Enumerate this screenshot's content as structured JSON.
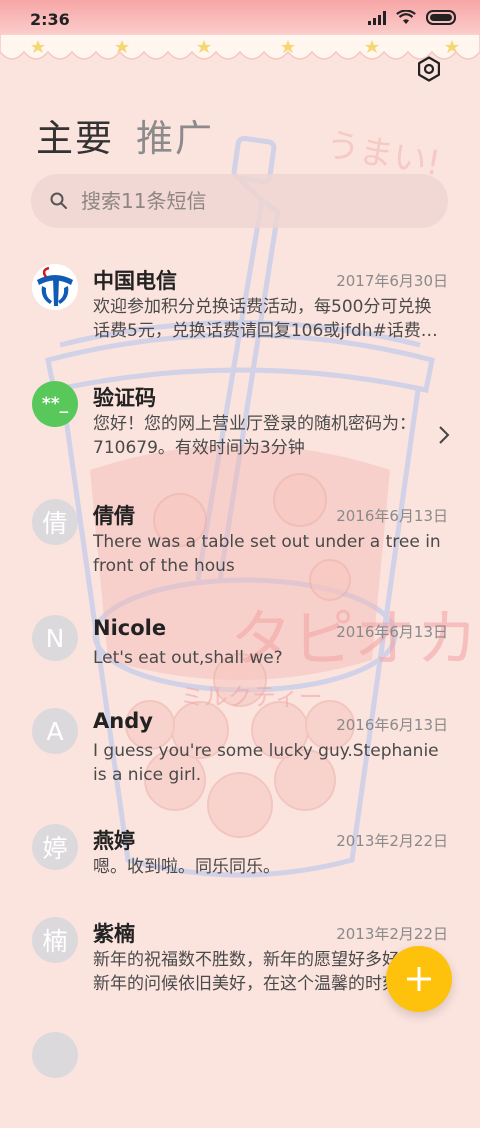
{
  "status": {
    "time": "2:36"
  },
  "tabs": [
    {
      "label": "主要",
      "active": true
    },
    {
      "label": "推广",
      "active": false
    }
  ],
  "search": {
    "placeholder": "搜索11条短信"
  },
  "messages": [
    {
      "name": "中国电信",
      "date": "2017年6月30日",
      "preview": "欢迎参加积分兑换话费活动，每500分可兑换话费5元，兑换话费请回复106或jfdh#话费…",
      "avatar": "telecom-logo"
    },
    {
      "name": "验证码",
      "date": "",
      "preview": "您好！您的网上营业厅登录的随机密码为：710679。有效时间为3分钟",
      "avatar_text": "**_"
    },
    {
      "name": "倩倩",
      "date": "2016年6月13日",
      "preview": "There was a table set out under a tree in front of the hous",
      "avatar_text": "倩"
    },
    {
      "name": "Nicole",
      "date": "2016年6月13日",
      "preview": "Let's eat out,shall we?",
      "avatar_text": "N"
    },
    {
      "name": "Andy",
      "date": "2016年6月13日",
      "preview": "I guess you're some lucky guy.Stephanie is a nice girl.",
      "avatar_text": "A"
    },
    {
      "name": "燕婷",
      "date": "2013年2月22日",
      "preview": "嗯。收到啦。同乐同乐。",
      "avatar_text": "婷"
    },
    {
      "name": "紫楠",
      "date": "2013年2月22日",
      "preview": "新年的祝福数不胜数，新年的愿望好多好多，新年的问候依旧美好，在这个温馨的时刻",
      "avatar_text": "楠"
    }
  ],
  "watermark": {
    "top_text": "うまい!",
    "main_text": "タピオカ",
    "sub_text": "ミルクティー"
  },
  "colors": {
    "background": "#fbe3de",
    "fab": "#fec10c",
    "verification_avatar": "#58c85b"
  }
}
